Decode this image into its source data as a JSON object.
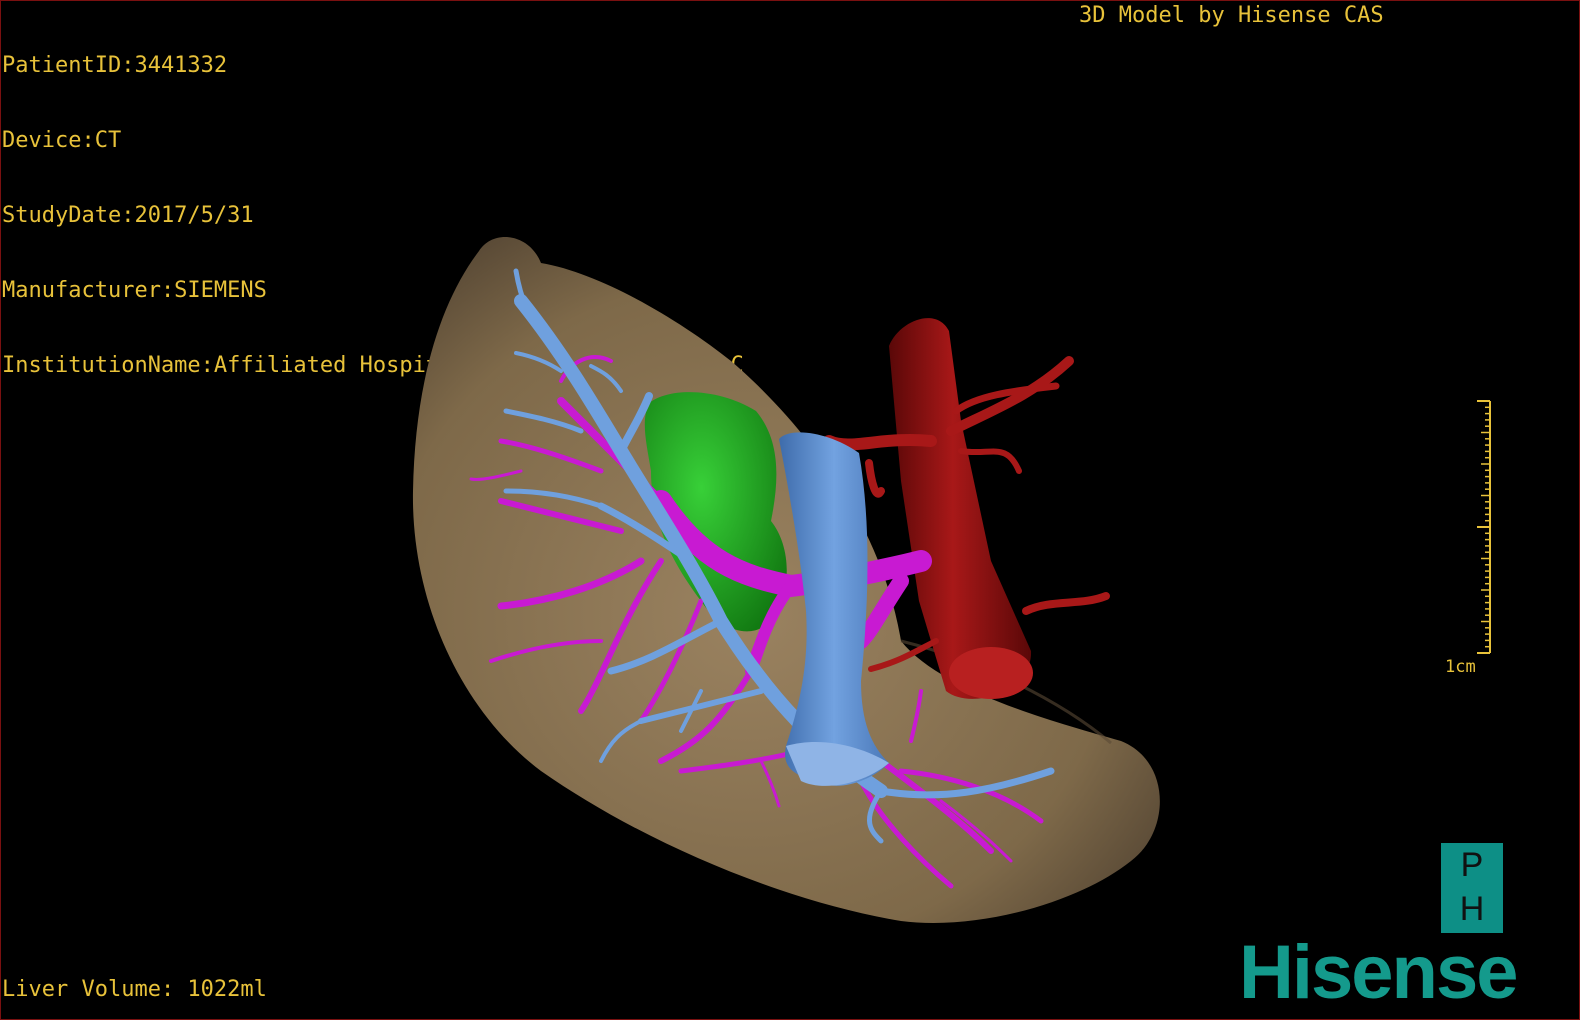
{
  "overlay": {
    "patient_id": "PatientID:3441332",
    "device": "Device:CT",
    "study_date": "StudyDate:2017/5/31",
    "manufacturer": "Manufacturer:SIEMENS",
    "institution": "InstitutionName:Affiliated Hospital Qingdao University-C",
    "model_credit": "3D Model by Hisense CAS",
    "liver_volume": "Liver Volume: 1022ml"
  },
  "scale_bar": {
    "label": "1cm"
  },
  "branding": {
    "badge_top": "P",
    "badge_bottom": "H",
    "logo_text": "Hisense"
  },
  "colors": {
    "overlay_text": "#e8c23a",
    "liver": "#8a7352",
    "portal_vein": "#c81ad2",
    "hepatic_vein": "#6fa0de",
    "gallbladder": "#1fa81f",
    "ivc": "#5b8fd3",
    "aorta": "#8c1010",
    "brand": "#149a8c"
  }
}
